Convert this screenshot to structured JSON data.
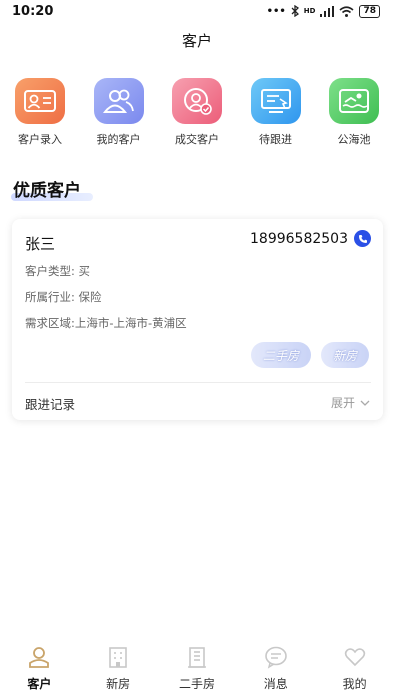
{
  "status_bar": {
    "time": "10:20",
    "signal_text": "HD",
    "battery": "78"
  },
  "nav": {
    "title": "客户"
  },
  "quick_actions": [
    {
      "label": "客户录入",
      "icon": "id-card-icon",
      "color_from": "#f8a06a",
      "color_to": "#ef6e44"
    },
    {
      "label": "我的客户",
      "icon": "users-icon",
      "color_from": "#a9b6f7",
      "color_to": "#7b89ee"
    },
    {
      "label": "成交客户",
      "icon": "deal-user-icon",
      "color_from": "#f7a0b0",
      "color_to": "#ec5d79"
    },
    {
      "label": "待跟进",
      "icon": "monitor-icon",
      "color_from": "#6fc9f7",
      "color_to": "#2f96ee"
    },
    {
      "label": "公海池",
      "icon": "swimming-icon",
      "color_from": "#7ee08a",
      "color_to": "#3fbe52"
    }
  ],
  "section": {
    "title": "优质客户"
  },
  "customer_card": {
    "name": "张三",
    "phone": "18996582503",
    "type": "客户类型: 买",
    "industry": "所属行业: 保险",
    "region": "需求区域:上海市-上海市-黄浦区",
    "tags": [
      "二手房",
      "新房"
    ],
    "follow_label": "跟进记录",
    "expand_label": "展开"
  },
  "tabbar": [
    {
      "label": "客户",
      "icon": "customer-icon",
      "active": true
    },
    {
      "label": "新房",
      "icon": "building-icon",
      "active": false
    },
    {
      "label": "二手房",
      "icon": "house-icon",
      "active": false
    },
    {
      "label": "消息",
      "icon": "message-icon",
      "active": false
    },
    {
      "label": "我的",
      "icon": "heart-icon",
      "active": false
    }
  ],
  "colors": {
    "accent": "#2b50e6",
    "tab_active": "#c9a46a"
  }
}
